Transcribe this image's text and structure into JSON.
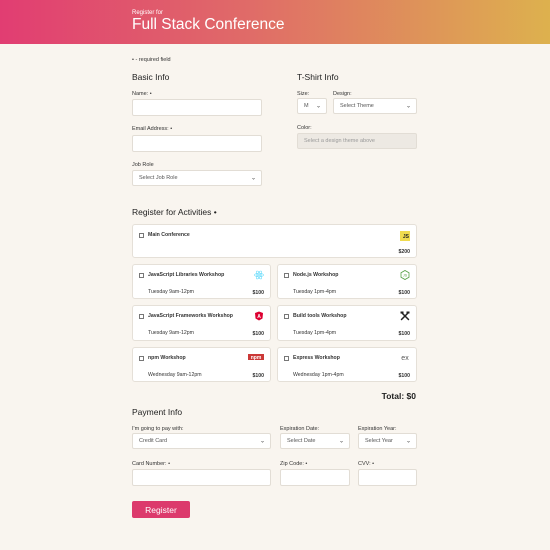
{
  "header": {
    "pre_title": "Register for",
    "title": "Full Stack Conference"
  },
  "required_note": "• - required field",
  "basic_info": {
    "heading": "Basic Info",
    "name_label": "Name: •",
    "email_label": "Email Address: •",
    "job_role_label": "Job Role",
    "job_role_value": "Select Job Role"
  },
  "tshirt": {
    "heading": "T-Shirt Info",
    "size_label": "Size:",
    "size_value": "M",
    "design_label": "Design:",
    "design_value": "Select Theme",
    "color_label": "Color:",
    "color_value": "Select a design theme above"
  },
  "activities": {
    "heading": "Register for Activities •",
    "items": [
      {
        "name": "Main Conference",
        "time": "",
        "price": "$200",
        "icon": "js-icon",
        "icon_color": "#f0db4f"
      },
      {
        "name": "JavaScript Libraries Workshop",
        "time": "Tuesday 9am-12pm",
        "price": "$100",
        "icon": "react-icon",
        "icon_color": "#61dafb"
      },
      {
        "name": "Node.js Workshop",
        "time": "Tuesday 1pm-4pm",
        "price": "$100",
        "icon": "nodejs-icon",
        "icon_color": "#539e43"
      },
      {
        "name": "JavaScript Frameworks Workshop",
        "time": "Tuesday 9am-12pm",
        "price": "$100",
        "icon": "angular-icon",
        "icon_color": "#dd0031"
      },
      {
        "name": "Build tools Workshop",
        "time": "Tuesday 1pm-4pm",
        "price": "$100",
        "icon": "tools-icon",
        "icon_color": "#222222"
      },
      {
        "name": "npm Workshop",
        "time": "Wednesday 9am-12pm",
        "price": "$100",
        "icon": "npm-icon",
        "icon_color": "#cb3837"
      },
      {
        "name": "Express Workshop",
        "time": "Wednesday 1pm-4pm",
        "price": "$100",
        "icon": "express-icon",
        "icon_color": "#555555"
      }
    ],
    "total": "Total: $0"
  },
  "payment": {
    "heading": "Payment Info",
    "pay_with_label": "I'm going to pay with:",
    "pay_with_value": "Credit Card",
    "exp_date_label": "Expiration Date:",
    "exp_date_value": "Select Date",
    "exp_year_label": "Expiration Year:",
    "exp_year_value": "Select Year",
    "card_number_label": "Card Number: •",
    "zip_label": "Zip Code: •",
    "cvv_label": "CVV: •"
  },
  "register_button": "Register"
}
